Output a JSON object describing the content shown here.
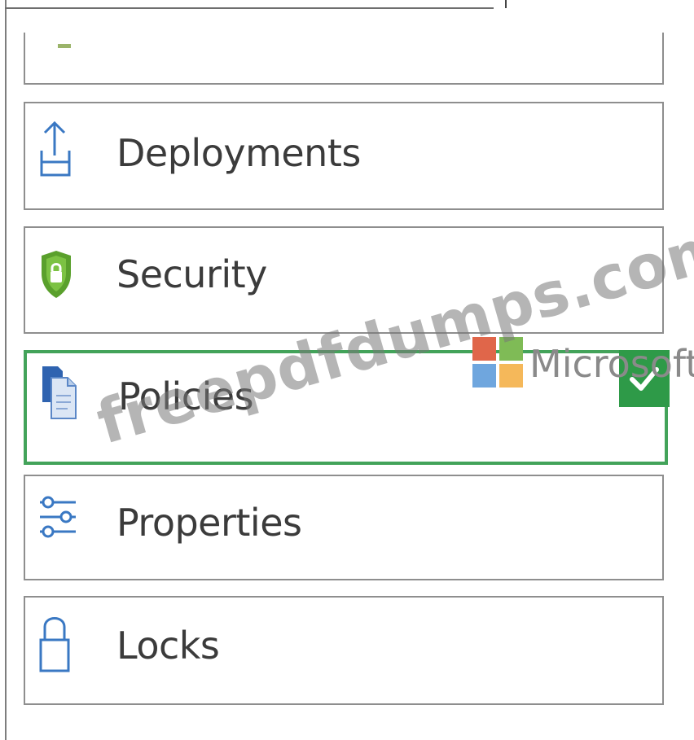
{
  "menu": {
    "items": [
      {
        "label": "",
        "icon": "partial-icon"
      },
      {
        "label": "Deployments",
        "icon": "upload-icon"
      },
      {
        "label": "Security",
        "icon": "shield-icon"
      },
      {
        "label": "Policies",
        "icon": "documents-icon",
        "selected": true
      },
      {
        "label": "Properties",
        "icon": "sliders-icon"
      },
      {
        "label": "Locks",
        "icon": "lock-icon"
      }
    ]
  },
  "overlay": {
    "watermark": "freepdfdumps.com",
    "brand_text": "Microsoft"
  },
  "colors": {
    "selected_border": "#43a35a",
    "check_badge": "#2e9a48",
    "icon_blue": "#3a78c3",
    "shield_green": "#5aa02c"
  }
}
